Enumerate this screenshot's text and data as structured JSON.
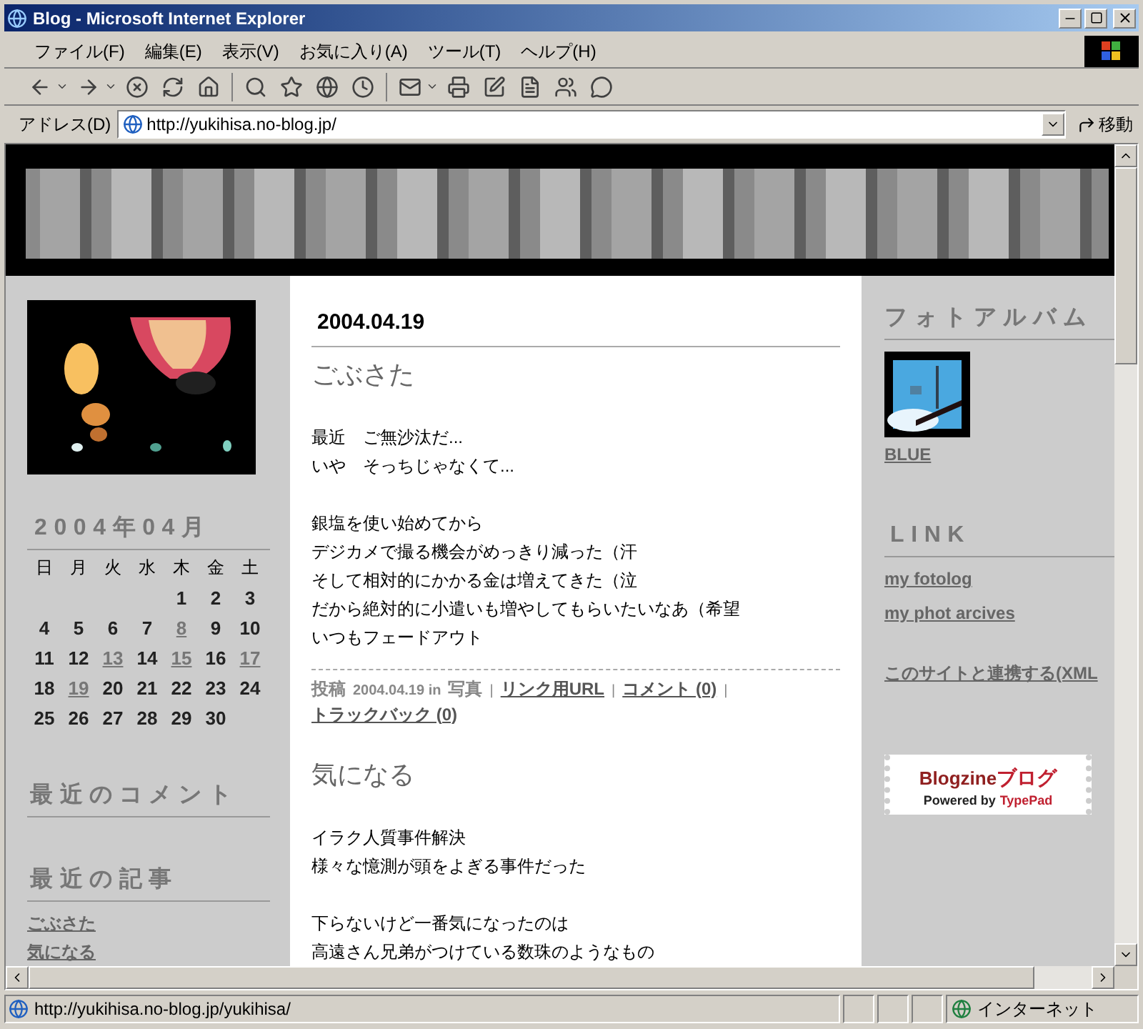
{
  "window": {
    "title": "Blog - Microsoft Internet Explorer"
  },
  "menu": [
    "ファイル(F)",
    "編集(E)",
    "表示(V)",
    "お気に入り(A)",
    "ツール(T)",
    "ヘルプ(H)"
  ],
  "address_bar": {
    "label": "アドレス(D)",
    "value": "http://yukihisa.no-blog.jp/",
    "go_button": "移動"
  },
  "sidebar_left": {
    "calendar": {
      "title": "2004年04月",
      "weekdays": [
        "日",
        "月",
        "火",
        "水",
        "木",
        "金",
        "土"
      ],
      "weeks": [
        [
          {
            "kind": "blank"
          },
          {
            "kind": "blank"
          },
          {
            "kind": "blank"
          },
          {
            "kind": "blank"
          },
          {
            "kind": "day",
            "text": "1",
            "linked": false
          },
          {
            "kind": "day",
            "text": "2",
            "linked": false
          },
          {
            "kind": "day",
            "text": "3",
            "linked": false
          }
        ],
        [
          {
            "kind": "day",
            "text": "4",
            "linked": false
          },
          {
            "kind": "day",
            "text": "5",
            "linked": false
          },
          {
            "kind": "day",
            "text": "6",
            "linked": false
          },
          {
            "kind": "day",
            "text": "7",
            "linked": false
          },
          {
            "kind": "day",
            "text": "8",
            "linked": true
          },
          {
            "kind": "day",
            "text": "9",
            "linked": false
          },
          {
            "kind": "day",
            "text": "10",
            "linked": false
          }
        ],
        [
          {
            "kind": "day",
            "text": "11",
            "linked": false
          },
          {
            "kind": "day",
            "text": "12",
            "linked": false
          },
          {
            "kind": "day",
            "text": "13",
            "linked": true
          },
          {
            "kind": "day",
            "text": "14",
            "linked": false
          },
          {
            "kind": "day",
            "text": "15",
            "linked": true
          },
          {
            "kind": "day",
            "text": "16",
            "linked": false
          },
          {
            "kind": "day",
            "text": "17",
            "linked": true
          }
        ],
        [
          {
            "kind": "day",
            "text": "18",
            "linked": false
          },
          {
            "kind": "day",
            "text": "19",
            "linked": true
          },
          {
            "kind": "day",
            "text": "20",
            "linked": false
          },
          {
            "kind": "day",
            "text": "21",
            "linked": false
          },
          {
            "kind": "day",
            "text": "22",
            "linked": false
          },
          {
            "kind": "day",
            "text": "23",
            "linked": false
          },
          {
            "kind": "day",
            "text": "24",
            "linked": false
          }
        ],
        [
          {
            "kind": "day",
            "text": "25",
            "linked": false
          },
          {
            "kind": "day",
            "text": "26",
            "linked": false
          },
          {
            "kind": "day",
            "text": "27",
            "linked": false
          },
          {
            "kind": "day",
            "text": "28",
            "linked": false
          },
          {
            "kind": "day",
            "text": "29",
            "linked": false
          },
          {
            "kind": "day",
            "text": "30",
            "linked": false
          },
          {
            "kind": "blank"
          }
        ]
      ]
    },
    "sections": [
      {
        "title": "最近のコメント"
      },
      {
        "title": "最近の記事",
        "links": [
          "ごぶさた",
          "気になる"
        ]
      }
    ]
  },
  "posts": [
    {
      "date": "2004.04.19",
      "title": "ごぶさた",
      "paragraphs": [
        [
          "最近　ご無沙汰だ...",
          "いや　そっちじゃなくて..."
        ],
        [
          "銀塩を使い始めてから",
          "デジカメで撮る機会がめっきり減った（汗",
          "そして相対的にかかる金は増えてきた（泣",
          "だから絶対的に小遣いも増やしてもらいたいなあ（希望",
          "いつもフェードアウト"
        ]
      ],
      "footer": {
        "label": "投稿",
        "date": "2004.04.19",
        "in": "in",
        "category": "写真",
        "separator": "|",
        "links": [
          "リンク用URL",
          "コメント (0)",
          "トラックバック (0)"
        ]
      }
    },
    {
      "title": "気になる",
      "paragraphs": [
        [
          "イラク人質事件解決",
          "様々な憶測が頭をよぎる事件だった"
        ],
        [
          "下らないけど一番気になったのは",
          "高遠さん兄弟がつけている数珠のようなもの"
        ]
      ]
    }
  ],
  "sidebar_right": {
    "photo_album": {
      "title": "フォトアルバム",
      "items": [
        {
          "caption": "BLUE"
        }
      ]
    },
    "link": {
      "title": "LINK",
      "links": [
        "my fotolog",
        "my phot arcives"
      ]
    },
    "syndicate": "このサイトと連携する(XML",
    "banner": {
      "brand": "Blogzine",
      "brand_jp": "ブログ",
      "tagline": "Powered by",
      "platform": "TypePad"
    }
  },
  "status_bar": {
    "url": "http://yukihisa.no-blog.jp/yukihisa/",
    "zone": "インターネット"
  }
}
